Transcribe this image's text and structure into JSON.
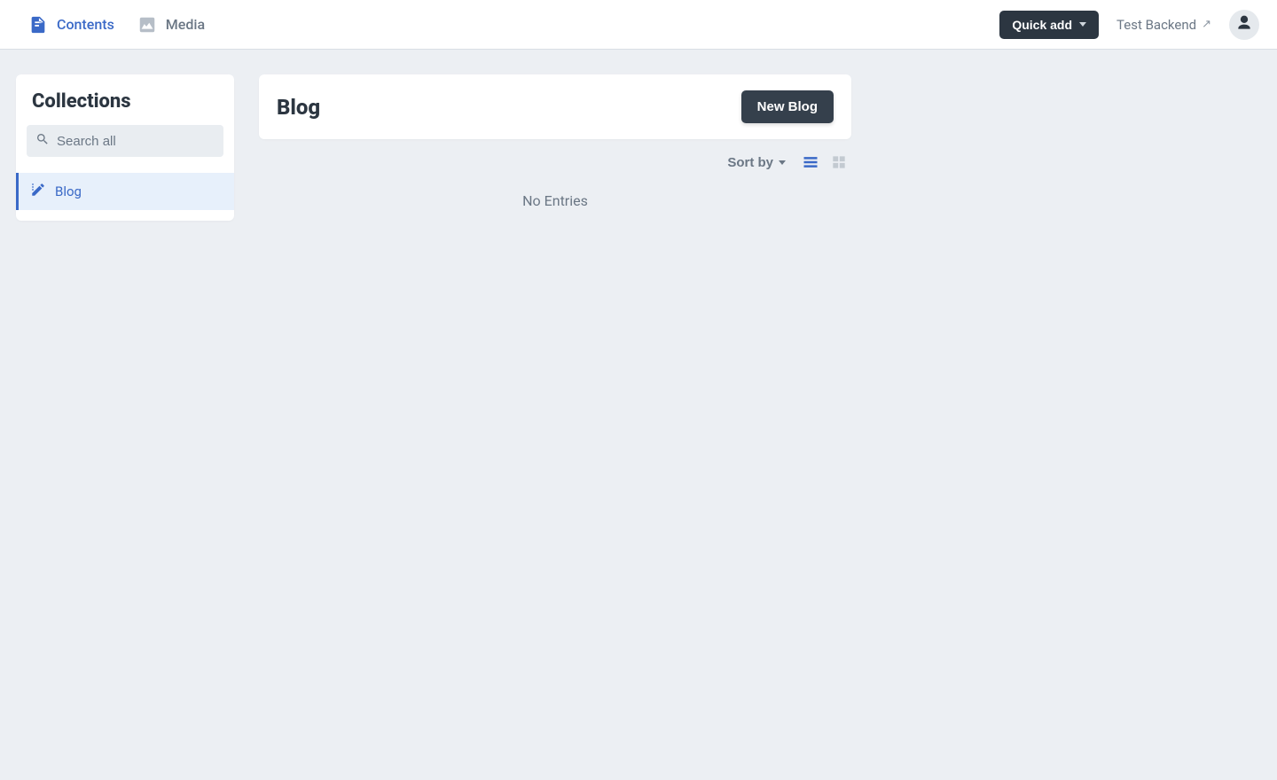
{
  "nav": {
    "contents_label": "Contents",
    "media_label": "Media",
    "quick_add_label": "Quick add",
    "backend_link_label": "Test Backend"
  },
  "sidebar": {
    "title": "Collections",
    "search_placeholder": "Search all",
    "items": [
      {
        "label": "Blog"
      }
    ]
  },
  "main": {
    "title": "Blog",
    "new_button_label": "New Blog",
    "sort_label": "Sort by",
    "empty_label": "No Entries"
  }
}
